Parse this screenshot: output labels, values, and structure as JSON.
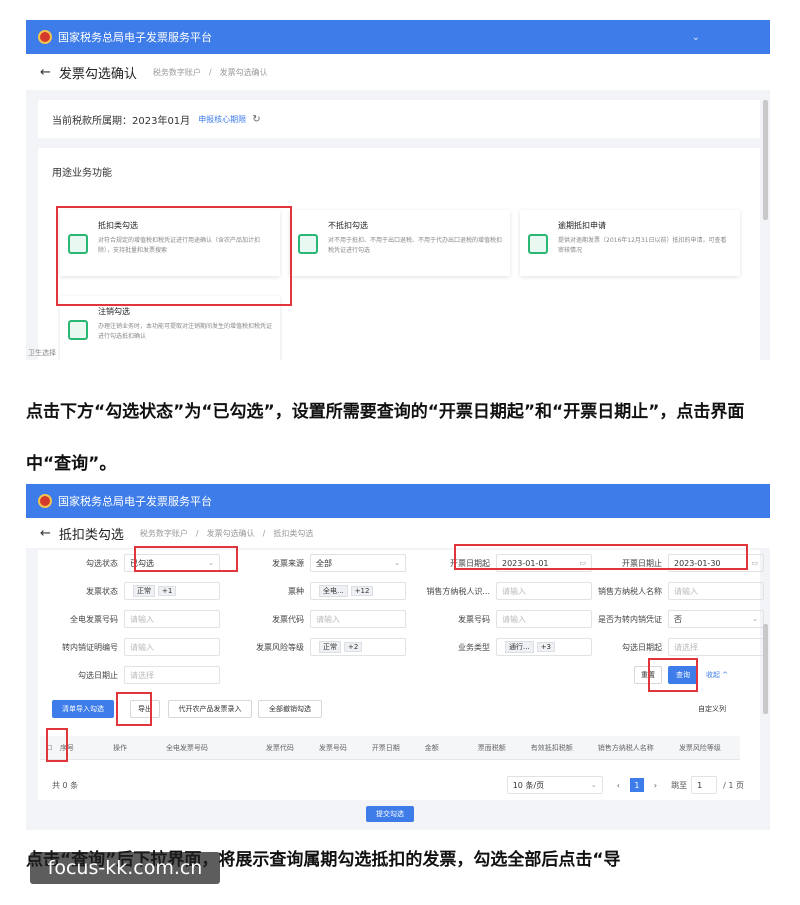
{
  "platform_title": "国家税务总局电子发票服务平台",
  "screen1": {
    "page_title": "发票勾选确认",
    "breadcrumbs": [
      "税务数字账户",
      "发票勾选确认"
    ],
    "period_label": "当前税款所属期：2023年01月",
    "period_link": "申报核心期限",
    "section_title": "用途业务功能",
    "cards": [
      {
        "title": "抵扣类勾选",
        "desc": "对符合规定的增值税扣税凭证进行用途确认（含农产品加计扣除），支持批量和发票搜索"
      },
      {
        "title": "不抵扣勾选",
        "desc": "对不用于抵扣、不用于出口退税、不用于代办出口退税的增值税扣税凭证进行勾选"
      },
      {
        "title": "逾期抵扣申请",
        "desc": "提供对逾期发票（2016年12月31日以前）抵扣的申请，可查看审核情况"
      },
      {
        "title": "注销勾选",
        "desc": "办理注销业务时，本功能可提取对注销期间发生的增值税扣税凭证进行勾选抵扣确认"
      }
    ],
    "footnote": "卫生选择"
  },
  "instruction_1": "点击下方“勾选状态”为“已勾选”，设置所需要查询的“开票日期起”和“开票日期止”，点击界面中“查询”。",
  "screen2": {
    "page_title": "抵扣类勾选",
    "breadcrumbs": [
      "税务数字账户",
      "发票勾选确认",
      "抵扣类勾选"
    ],
    "filters": {
      "check_status_label": "勾选状态",
      "check_status_value": "已勾选",
      "source_label": "发票来源",
      "source_value": "全部",
      "date_start_label": "开票日期起",
      "date_start_value": "2023-01-01",
      "date_end_label": "开票日期止",
      "date_end_value": "2023-01-30",
      "invoice_status_label": "发票状态",
      "invoice_status_value": "正常",
      "invoice_status_more": "+1",
      "type_label": "票种",
      "type_value": "全电...",
      "type_more": "+12",
      "seller_tax_id_label": "销售方纳税人识...",
      "seller_tax_id_ph": "请输入",
      "seller_name_label": "销售方纳税人名称",
      "seller_name_ph": "请输入",
      "digital_no_label": "全电发票号码",
      "digital_no_ph": "请输入",
      "invoice_code_label": "发票代码",
      "invoice_code_ph": "请输入",
      "invoice_no_label": "发票号码",
      "invoice_no_ph": "请输入",
      "transfer_label": "是否为转内销凭证",
      "transfer_value": "否",
      "transfer_no_label": "转内销证明编号",
      "transfer_no_ph": "请输入",
      "risk_label": "发票风险等级",
      "risk_value": "正常",
      "risk_more": "+2",
      "biz_type_label": "业务类型",
      "biz_type_value": "通行...",
      "biz_type_more": "+3",
      "check_date_start_label": "勾选日期起",
      "check_date_start_ph": "请选择",
      "check_date_end_label": "勾选日期止",
      "check_date_end_ph": "请选择"
    },
    "buttons": {
      "reset": "重置",
      "query": "查询",
      "collapse": "收起",
      "import": "清单导入勾选",
      "export": "导出",
      "agri": "代开农产品发票录入",
      "cancel_all": "全部撤销勾选",
      "custom_cols": "自定义列"
    },
    "table_headers": [
      "序号",
      "操作",
      "全电发票号码",
      "发票代码",
      "发票号码",
      "开票日期",
      "金额",
      "票面税额",
      "有效抵扣税额",
      "销售方纳税人名称",
      "发票风险等级"
    ],
    "total": "共 0 条",
    "page_size": "10 条/页",
    "page_current": "1",
    "goto_label": "跳至",
    "goto_value": "1",
    "page_total": "/ 1 页",
    "submit": "提交勾选"
  },
  "instruction_2": "点击“查询”后下拉界面，将展示查询属期勾选抵扣的发票，勾选全部后点击“导",
  "watermark": "focus-kk.com.cn"
}
